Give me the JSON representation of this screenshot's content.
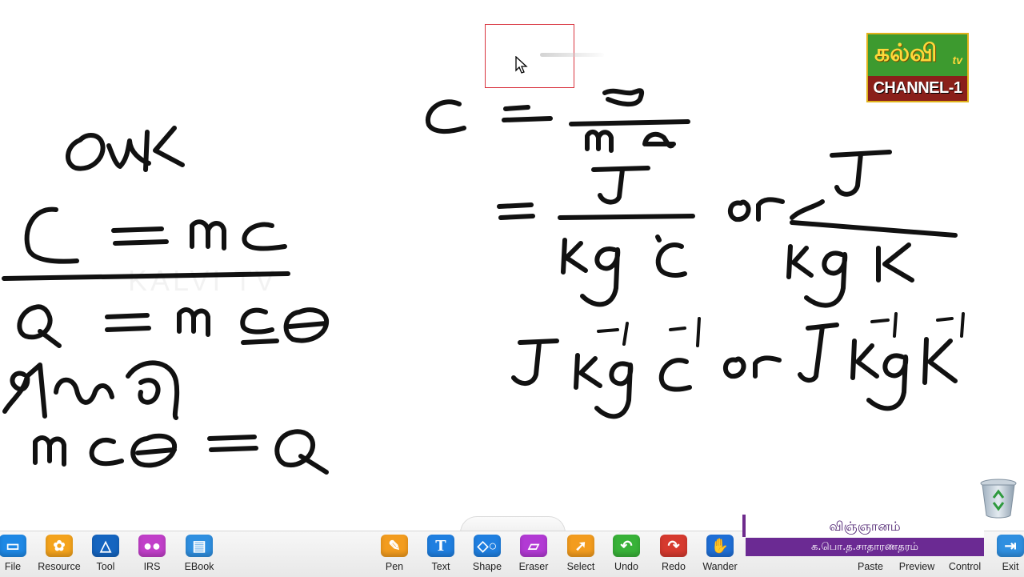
{
  "logo": {
    "script_text": "கல்வி",
    "tv_text": "tv",
    "channel_text": "CHANNEL-1"
  },
  "caption": {
    "subject": "விஞ்ஞானம்",
    "level": "க.பொ.த.சாதாரணதரம்"
  },
  "toolbar": {
    "left_tools": [
      {
        "label": "File",
        "icon": "folder-icon",
        "color": "#1e88e5"
      },
      {
        "label": "Resource",
        "icon": "resource-icon",
        "color": "#f4a31c"
      },
      {
        "label": "Tool",
        "icon": "triangle-ruler-icon",
        "color": "#1565c0"
      },
      {
        "label": "IRS",
        "icon": "users-icon",
        "color": "#c13fc9"
      },
      {
        "label": "EBook",
        "icon": "book-icon",
        "color": "#2f8fe0"
      }
    ],
    "center_tools": [
      {
        "label": "Pen",
        "icon": "pen-icon",
        "color": "#f39c1e"
      },
      {
        "label": "Text",
        "icon": "text-icon",
        "color": "#1f7fe0"
      },
      {
        "label": "Shape",
        "icon": "shape-icon",
        "color": "#1f7fe0"
      },
      {
        "label": "Eraser",
        "icon": "eraser-icon",
        "color": "#b23ad4",
        "active": true
      },
      {
        "label": "Select",
        "icon": "select-arrow-icon",
        "color": "#f39c1e"
      },
      {
        "label": "Undo",
        "icon": "undo-icon",
        "color": "#38b238"
      },
      {
        "label": "Redo",
        "icon": "redo-icon",
        "color": "#d63a2f"
      },
      {
        "label": "Wander",
        "icon": "hand-icon",
        "color": "#1f6fd6"
      }
    ],
    "right_tools": [
      {
        "label": "Paste",
        "icon": "paste-icon"
      },
      {
        "label": "Preview",
        "icon": "preview-icon"
      },
      {
        "label": "Control",
        "icon": "control-icon"
      },
      {
        "label": "Exit",
        "icon": "exit-icon",
        "color": "#2f8fe0"
      }
    ]
  }
}
